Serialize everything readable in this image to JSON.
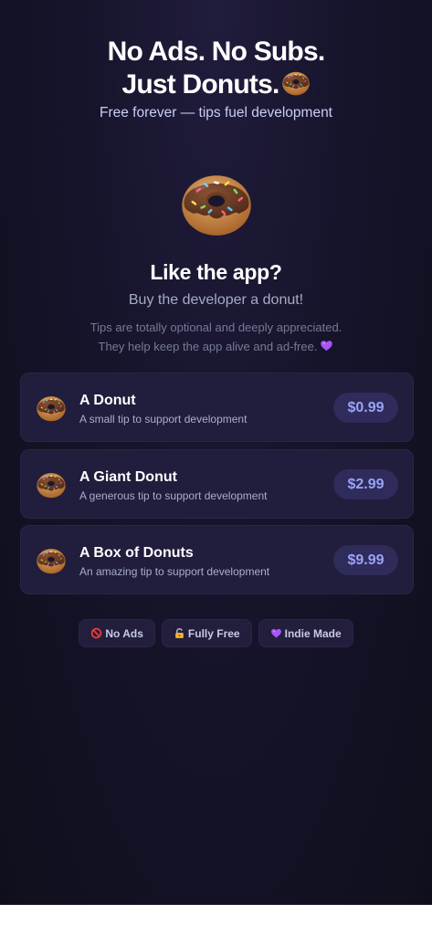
{
  "hero": {
    "title_line1": "No Ads. No Subs.",
    "title_line2": "Just Donuts.",
    "subtitle": "Free forever — tips fuel development"
  },
  "support": {
    "title": "Like the app?",
    "subtitle": "Buy the developer a donut!",
    "description_line1": "Tips are totally optional and deeply appreciated.",
    "description_line2": "They help keep the app alive and ad-free."
  },
  "tips": [
    {
      "name": "A Donut",
      "description": "A small tip to support development",
      "price": "$0.99"
    },
    {
      "name": "A Giant Donut",
      "description": "A generous tip to support development",
      "price": "$2.99"
    },
    {
      "name": "A Box of Donuts",
      "description": "An amazing tip to support development",
      "price": "$9.99"
    }
  ],
  "badges": [
    {
      "label": "No Ads",
      "icon": "no-entry-icon"
    },
    {
      "label": "Fully Free",
      "icon": "lock-icon"
    },
    {
      "label": "Indie Made",
      "icon": "purple-heart-icon"
    }
  ],
  "colors": {
    "background": "#16142b",
    "card": "#211d3c",
    "price_button": "#2f2b5a",
    "price_text": "#9aa3f8",
    "heart": "#a855f7"
  }
}
